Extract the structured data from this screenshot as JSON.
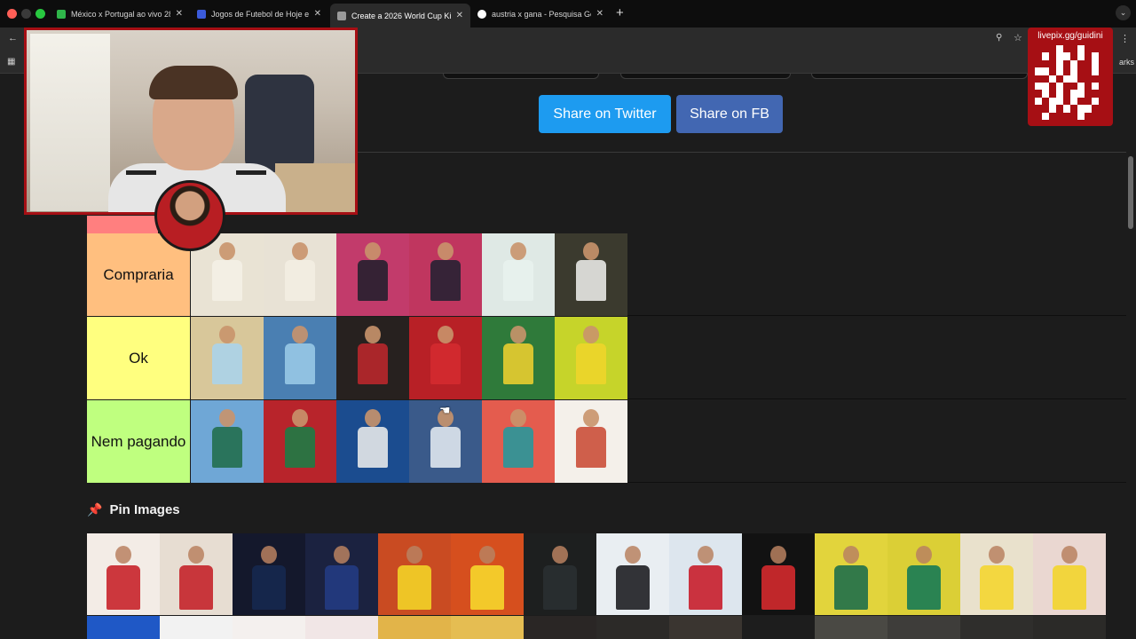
{
  "browser": {
    "tabs": [
      {
        "title": "México x Portugal ao vivo 28/",
        "favicon_color": "#2fb54a"
      },
      {
        "title": "Jogos de Futebol de Hoje e R",
        "favicon_color": "#3b5bdb"
      },
      {
        "title": "Create a 2026 World Cup Kit",
        "favicon_color": "#9a9a9a",
        "active": true
      },
      {
        "title": "austria x gana - Pesquisa Goo",
        "favicon_color": "#ffffff"
      }
    ],
    "new_tab_symbol": "+",
    "bookmarks_partial": "arks"
  },
  "share": {
    "twitter_label": "Share on Twitter",
    "fb_label": "Share on FB",
    "twitter_color": "#1d9bf0",
    "fb_color": "#4267b2"
  },
  "tiers": [
    {
      "label": "Compraria",
      "color": "#ffbf7f",
      "items": [
        {
          "bg": "#e9e3d4",
          "kit": "#f4f1e6"
        },
        {
          "bg": "#e8e2d5",
          "kit": "#f3efe3"
        },
        {
          "bg": "#c23b6b",
          "kit": "#1c1f2a"
        },
        {
          "bg": "#c0365f",
          "kit": "#1d2030"
        },
        {
          "bg": "#dfe9e5",
          "kit": "#e9f2ee"
        },
        {
          "bg": "#3b3a2e",
          "kit": "#f2f2ee"
        }
      ]
    },
    {
      "label": "Ok",
      "color": "#ffff7f",
      "items": [
        {
          "bg": "#d8c79a",
          "kit": "#a8d3ef"
        },
        {
          "bg": "#4a7fb2",
          "kit": "#9ccde9"
        },
        {
          "bg": "#27211f",
          "kit": "#c2272d"
        },
        {
          "bg": "#b82026",
          "kit": "#d52b30"
        },
        {
          "bg": "#2f7a3a",
          "kit": "#f3d22f"
        },
        {
          "bg": "#c6d42a",
          "kit": "#f0d52a"
        }
      ]
    },
    {
      "label": "Nem pagando",
      "color": "#bfff7f",
      "items": [
        {
          "bg": "#6fa7d6",
          "kit": "#1f6b46"
        },
        {
          "bg": "#b8242b",
          "kit": "#148046"
        },
        {
          "bg": "#1b4c8f",
          "kit": "#f1f1ef"
        },
        {
          "bg": "#3a5a8a",
          "kit": "#e9eef3"
        },
        {
          "bg": "#e45c4e",
          "kit": "#1d9aa0"
        },
        {
          "bg": "#f4f0ea",
          "kit": "#c8452f"
        }
      ]
    }
  ],
  "pin": {
    "title": "Pin Images",
    "icon": "pushpin-icon",
    "row1": [
      {
        "bg": "#f3ece6",
        "kit": "#c8242a"
      },
      {
        "bg": "#e7ddd2",
        "kit": "#c4232a"
      },
      {
        "bg": "#14182c",
        "kit": "#15284f"
      },
      {
        "bg": "#1b2240",
        "kit": "#233b82"
      },
      {
        "bg": "#c94b22",
        "kit": "#f2d327"
      },
      {
        "bg": "#d64f1e",
        "kit": "#f6d62b"
      },
      {
        "bg": "#1d1f1f",
        "kit": "#2a2f31"
      },
      {
        "bg": "#e9eef2",
        "kit": "#1e1e22"
      },
      {
        "bg": "#dde6ee",
        "kit": "#c81e2b"
      },
      {
        "bg": "#121212",
        "kit": "#d42a2e"
      },
      {
        "bg": "#e2d43c",
        "kit": "#1f6f4a"
      },
      {
        "bg": "#dbcf36",
        "kit": "#167a55"
      },
      {
        "bg": "#e9e1cc",
        "kit": "#f4d631"
      },
      {
        "bg": "#ead7d1",
        "kit": "#f3d52c"
      }
    ],
    "row2": [
      {
        "bg": "#1f58c6"
      },
      {
        "bg": "#f2f2f2"
      },
      {
        "bg": "#f4f0ee"
      },
      {
        "bg": "#f1e6e6"
      },
      {
        "bg": "#e2b449"
      },
      {
        "bg": "#e5bd52"
      },
      {
        "bg": "#2a2625"
      },
      {
        "bg": "#2c2a28"
      },
      {
        "bg": "#3a3530"
      },
      {
        "bg": "#1d1d1d"
      },
      {
        "bg": "#4a4944"
      },
      {
        "bg": "#3e3d3a"
      },
      {
        "bg": "#2f2e2c"
      },
      {
        "bg": "#2b2a28"
      }
    ]
  },
  "stream": {
    "qr_label": "livepix.gg/guidini",
    "overlay_color": "#a60f14"
  }
}
